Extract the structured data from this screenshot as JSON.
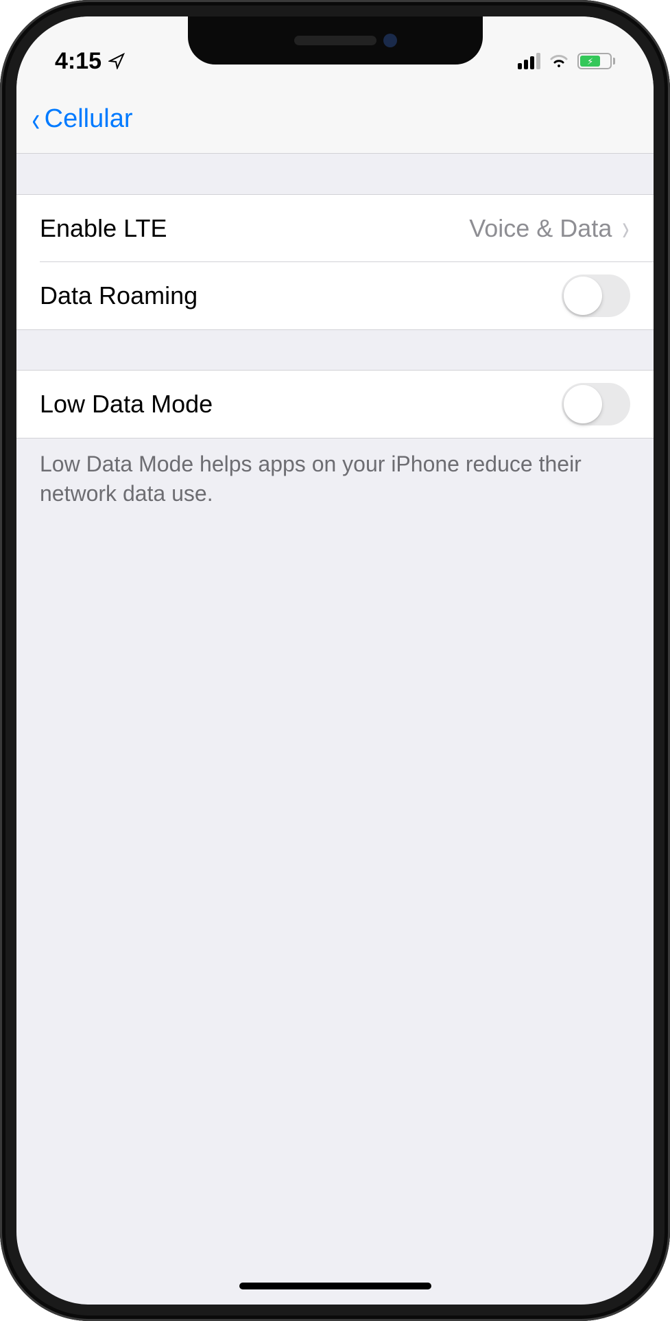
{
  "status": {
    "time": "4:15"
  },
  "nav": {
    "back_label": "Cellular"
  },
  "section1": {
    "enable_lte": {
      "label": "Enable LTE",
      "value": "Voice & Data"
    },
    "data_roaming": {
      "label": "Data Roaming",
      "on": false
    }
  },
  "section2": {
    "low_data_mode": {
      "label": "Low Data Mode",
      "on": false
    },
    "footer": "Low Data Mode helps apps on your iPhone reduce their network data use."
  }
}
